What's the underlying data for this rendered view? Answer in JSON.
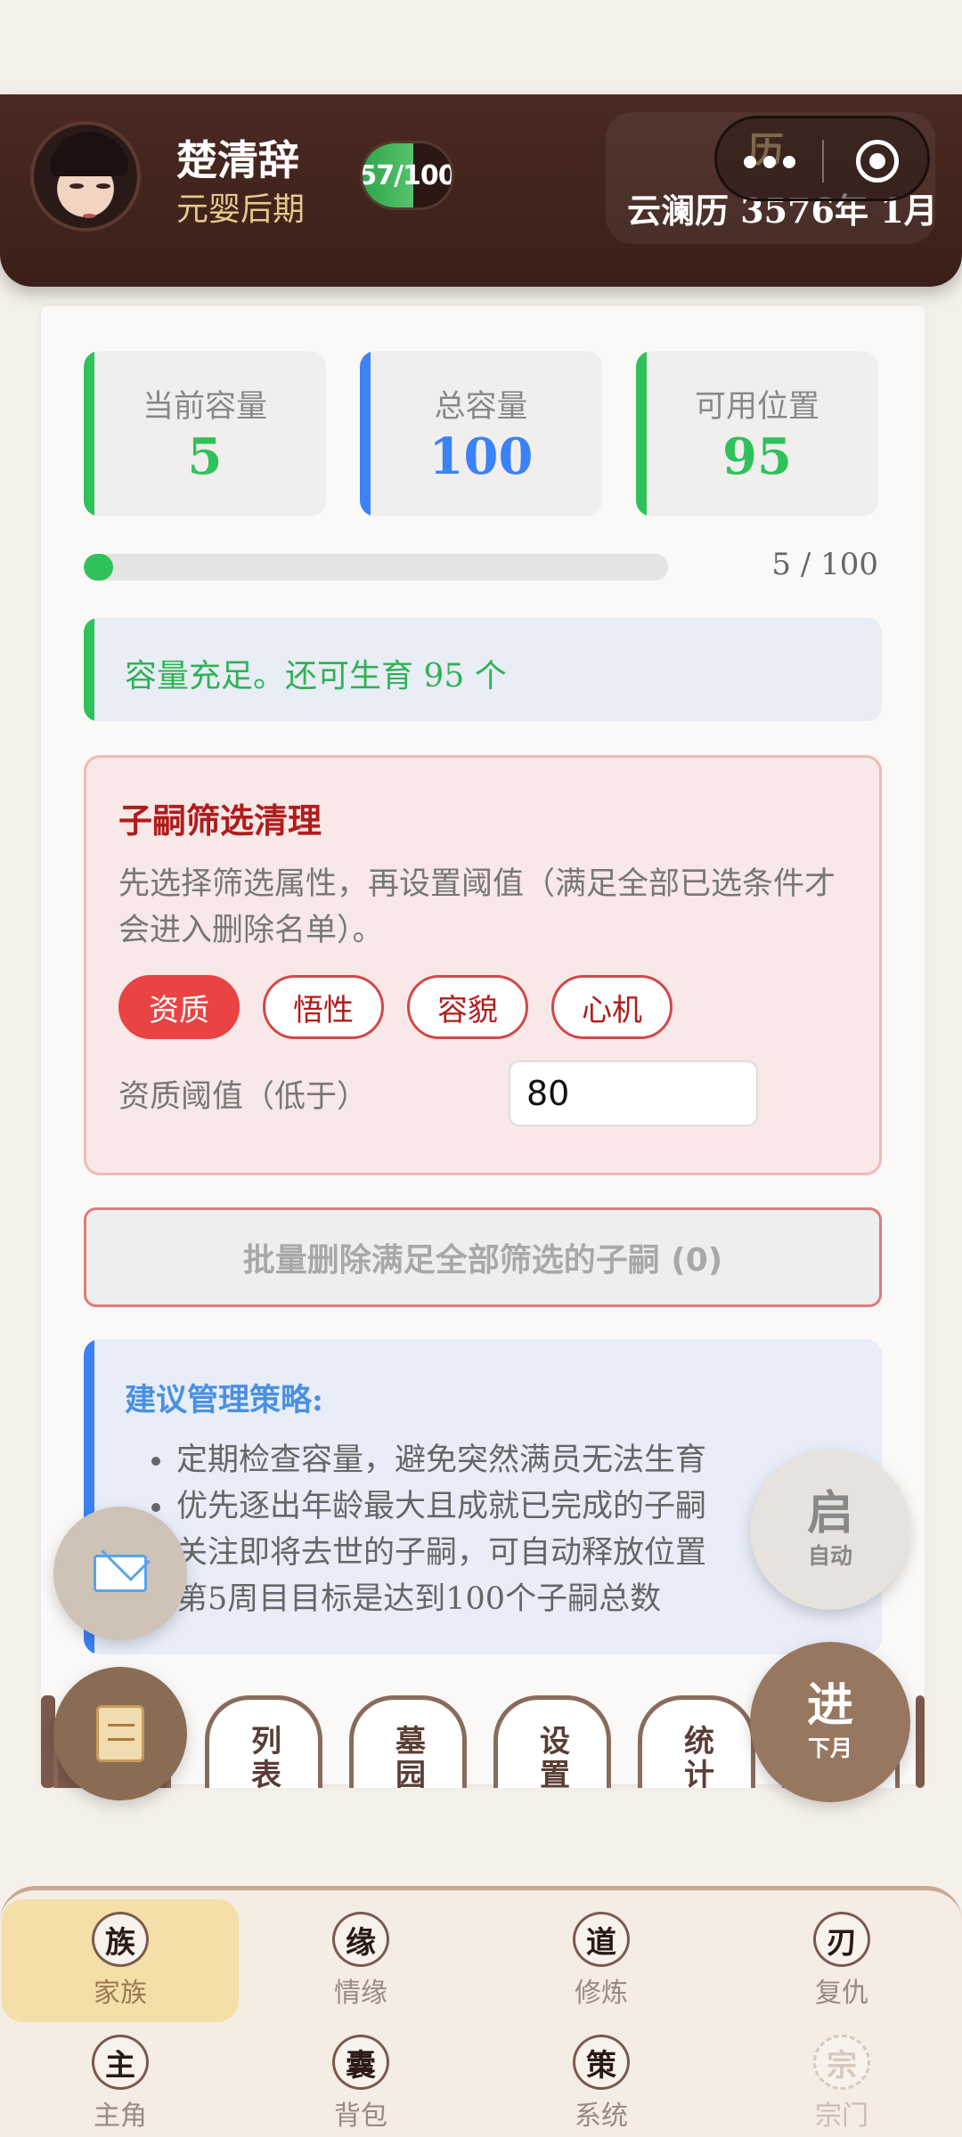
{
  "header": {
    "player_name": "楚清辞",
    "realm": "元婴后期",
    "hp_text": "57/100",
    "hp_progress_percent": 57,
    "calendar_icon_char": "历",
    "date_text": "云澜历 3576年 1月"
  },
  "stats": [
    {
      "label": "当前容量",
      "value": "5",
      "color": "#2fc25b"
    },
    {
      "label": "总容量",
      "value": "100",
      "color": "#3b82f6"
    },
    {
      "label": "可用位置",
      "value": "95",
      "color": "#2fc25b"
    }
  ],
  "progress": {
    "text": "5 / 100",
    "fill_percent": 5
  },
  "notice": {
    "text": "容量充足。还可生育 95 个"
  },
  "filter": {
    "title": "子嗣筛选清理",
    "description": "先选择筛选属性，再设置阈值（满足全部已选条件才会进入删除名单）。",
    "chips": [
      "资质",
      "悟性",
      "容貌",
      "心机"
    ],
    "active_chip": "资质",
    "threshold_label": "资质阈值（低于）",
    "threshold_value": "80"
  },
  "delete_button": "批量删除满足全部筛选的子嗣 (0)",
  "tips": {
    "title": "建议管理策略:",
    "items": [
      "定期检查容量，避免突然满员无法生育",
      "优先逐出年龄最大且成就已完成的子嗣",
      "关注即将去世的子嗣，可自动释放位置",
      "第5周目目标是达到100个子嗣总数"
    ]
  },
  "tabs": [
    "列表",
    "墓园",
    "设置",
    "统计"
  ],
  "fabs": {
    "auto_big": "启",
    "auto_small": "自动",
    "next_big": "进",
    "next_small": "下月"
  },
  "bottom_nav": [
    {
      "char": "族",
      "label": "家族",
      "active": true
    },
    {
      "char": "缘",
      "label": "情缘"
    },
    {
      "char": "道",
      "label": "修炼"
    },
    {
      "char": "刃",
      "label": "复仇"
    },
    {
      "char": "主",
      "label": "主角"
    },
    {
      "char": "囊",
      "label": "背包"
    },
    {
      "char": "策",
      "label": "系统"
    },
    {
      "char": "宗",
      "label": "宗门",
      "disabled": true
    }
  ]
}
